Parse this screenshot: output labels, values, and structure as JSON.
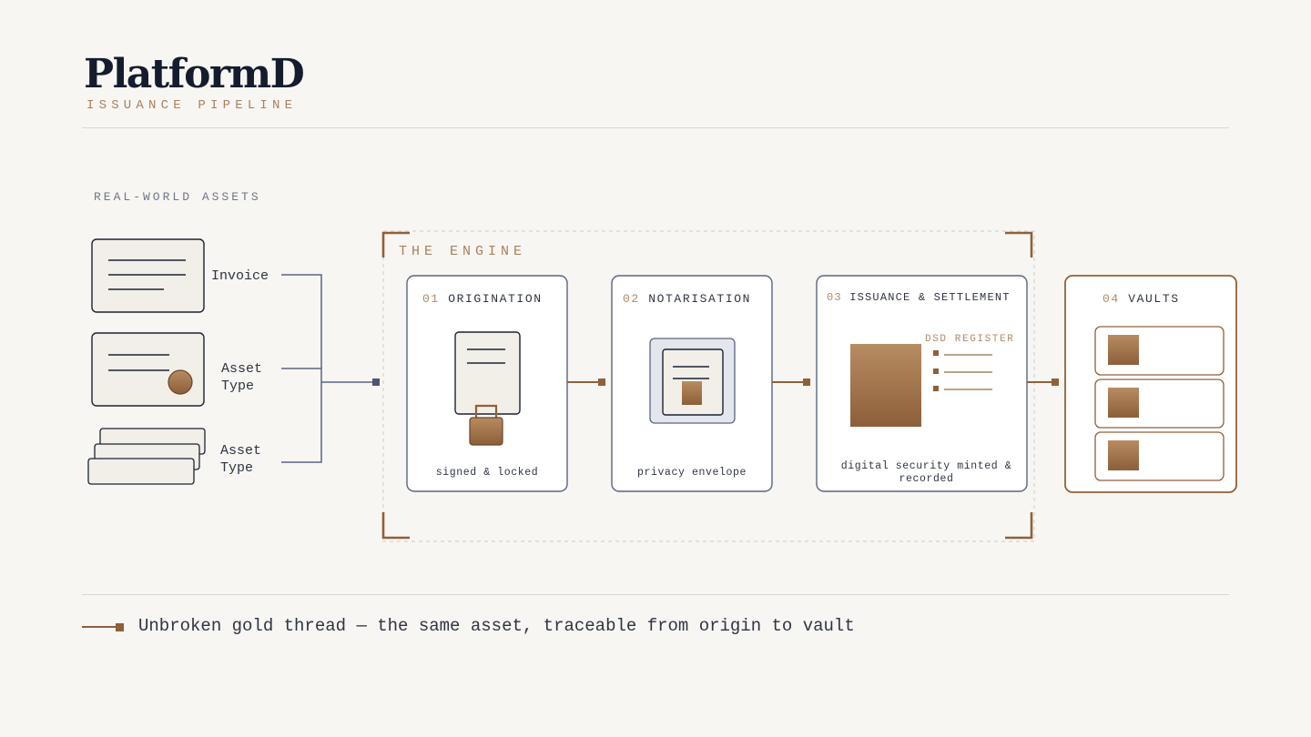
{
  "header": {
    "brand": "PlatformD",
    "subtitle": "ISSUANCE PIPELINE"
  },
  "inputs": {
    "section_label": "REAL-WORLD ASSETS",
    "items": [
      {
        "label": "Invoice",
        "icon": "invoice-document-icon"
      },
      {
        "label": "Asset\nType",
        "icon": "certificate-seal-icon"
      },
      {
        "label": "Asset\nType",
        "icon": "stacked-cards-icon"
      }
    ]
  },
  "engine": {
    "label": "THE ENGINE",
    "stages": [
      {
        "num": "01",
        "title": "ORIGINATION",
        "caption": "signed & locked",
        "icon": "locked-document-icon"
      },
      {
        "num": "02",
        "title": "NOTARISATION",
        "caption": "privacy envelope",
        "icon": "privacy-envelope-icon"
      },
      {
        "num": "03",
        "title": "ISSUANCE & SETTLEMENT",
        "caption": "digital security minted & recorded",
        "icon": "security-token-icon",
        "register_label": "DSD REGISTER"
      }
    ]
  },
  "vaults": {
    "num": "04",
    "title": "VAULTS",
    "count": 3,
    "icon": "vault-icon"
  },
  "legend": {
    "text": "Unbroken gold thread — the same asset, traceable from origin to vault",
    "icon": "gold-thread-icon"
  },
  "colors": {
    "background": "#f8f6f2",
    "navy": "#141c2e",
    "slate": "#5a6482",
    "gold": "#8f603a",
    "gold_light": "#b58c64"
  }
}
